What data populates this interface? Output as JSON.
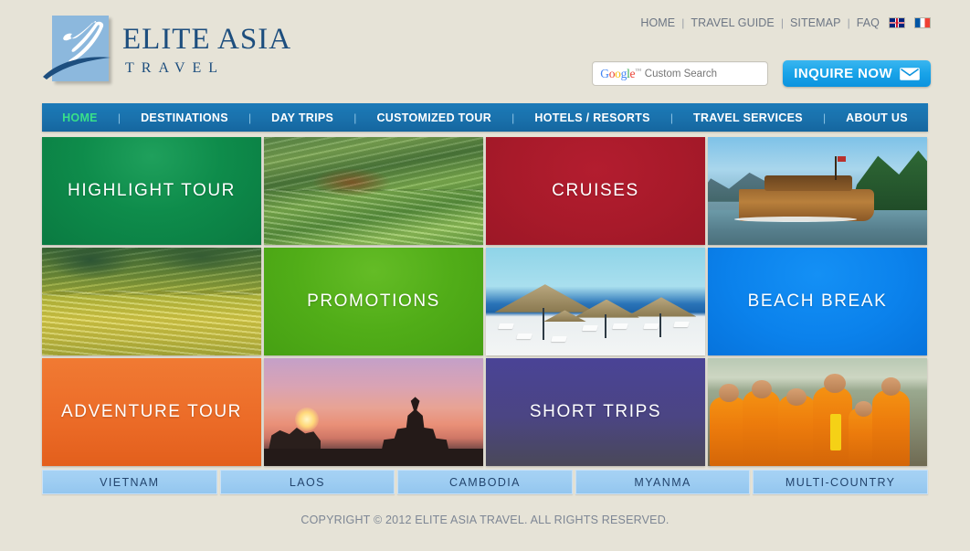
{
  "site": {
    "logo": {
      "title_line1": "ELITE ASIA",
      "title_line2": "TRAVEL",
      "mark_icon": "bird-sail-logo-icon"
    },
    "brand_color": "#1d4e7e",
    "nav_bar_color": "#1a72ad",
    "accent_color": "#19a3e8"
  },
  "utility": {
    "links": [
      {
        "label": "HOME"
      },
      {
        "label": "TRAVEL GUIDE"
      },
      {
        "label": "SITEMAP"
      },
      {
        "label": "FAQ"
      }
    ],
    "separator": "|",
    "flags": [
      {
        "name": "flag-uk-icon",
        "label": "English"
      },
      {
        "name": "flag-fr-icon",
        "label": "Français"
      }
    ]
  },
  "search": {
    "brand": "Google",
    "trademark": "™",
    "placeholder": "Custom Search",
    "value": "",
    "icon": "search-icon"
  },
  "inquire": {
    "label": "INQUIRE NOW",
    "icon": "envelope-icon"
  },
  "mainnav": {
    "items": [
      {
        "label": "HOME",
        "active": true
      },
      {
        "label": "DESTINATIONS",
        "active": false
      },
      {
        "label": "DAY TRIPS",
        "active": false
      },
      {
        "label": "CUSTOMIZED TOUR",
        "active": false
      },
      {
        "label": "HOTELS / RESORTS",
        "active": false
      },
      {
        "label": "TRAVEL SERVICES",
        "active": false
      },
      {
        "label": "ABOUT US",
        "active": false
      }
    ],
    "divider": "|",
    "active_color": "#38e08a"
  },
  "tiles": [
    {
      "label": "HIGHLIGHT TOUR",
      "kind": "color",
      "color": "#0e8c4b",
      "name": "tile-highlight-tour"
    },
    {
      "label": "",
      "kind": "photo",
      "photo": "rice-terraces-green-photo",
      "name": "tile-photo-rice-terraces-green"
    },
    {
      "label": "CRUISES",
      "kind": "color",
      "color": "#a81a2a",
      "name": "tile-cruises"
    },
    {
      "label": "",
      "kind": "photo",
      "photo": "river-cruise-boat-photo",
      "name": "tile-photo-river-cruise-boat"
    },
    {
      "label": "",
      "kind": "photo",
      "photo": "rice-terraces-yellow-photo",
      "name": "tile-photo-rice-terraces-yellow"
    },
    {
      "label": "PROMOTIONS",
      "kind": "color",
      "color": "#51ad18",
      "name": "tile-promotions"
    },
    {
      "label": "",
      "kind": "photo",
      "photo": "beach-umbrellas-photo",
      "name": "tile-photo-beach-umbrellas"
    },
    {
      "label": "BEACH BREAK",
      "kind": "color",
      "color": "#0b82ec",
      "name": "tile-beach-break"
    },
    {
      "label": "ADVENTURE TOUR",
      "kind": "color",
      "color": "#ec6c28",
      "name": "tile-adventure-tour"
    },
    {
      "label": "",
      "kind": "photo",
      "photo": "temple-sunset-photo",
      "name": "tile-photo-temple-sunset"
    },
    {
      "label": "SHORT TRIPS",
      "kind": "color",
      "color": "#4b4583",
      "name": "tile-short-trips"
    },
    {
      "label": "",
      "kind": "photo",
      "photo": "monks-alms-photo",
      "name": "tile-photo-monks-alms"
    }
  ],
  "countries": [
    {
      "label": "VIETNAM"
    },
    {
      "label": "LAOS"
    },
    {
      "label": "CAMBODIA"
    },
    {
      "label": "MYANMA"
    },
    {
      "label": "MULTI-COUNTRY"
    }
  ],
  "footer": {
    "copyright": "COPYRIGHT © 2012 ELITE ASIA TRAVEL. ALL RIGHTS RESERVED."
  }
}
